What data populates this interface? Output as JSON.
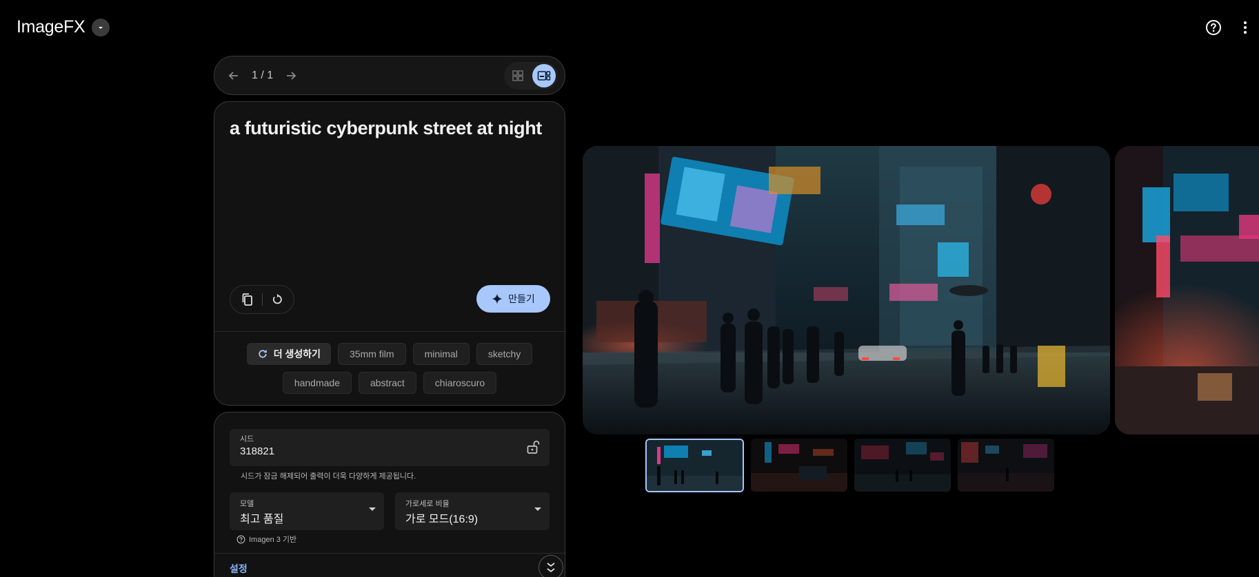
{
  "header": {
    "app_name": "ImageFX",
    "help_icon": "help-circle-icon",
    "more_icon": "more-vert-icon"
  },
  "pager": {
    "count": "1 / 1",
    "prev_icon": "arrow-left-icon",
    "next_icon": "arrow-right-icon",
    "views": [
      "grid-view-icon",
      "carousel-view-icon"
    ]
  },
  "prompt": {
    "text": "a futuristic cyberpunk street at night",
    "create_label": "만들기",
    "refresh_label": "더 생성하기",
    "chips": [
      "35mm film",
      "minimal",
      "sketchy",
      "handmade",
      "abstract",
      "chiaroscuro"
    ]
  },
  "settings": {
    "seed_label": "시드",
    "seed_value": "318821",
    "seed_hint": "시드가 잠금 해제되어 출력이 더욱 다양하게 제공됩니다.",
    "model_label": "모델",
    "model_value": "최고 품질",
    "ratio_label": "가로세로 비율",
    "ratio_value": "가로 모드(16:9)",
    "imagen_note": "Imagen 3 기반",
    "settings_label": "설정"
  },
  "colors": {
    "accent": "#a8c7fa",
    "link": "#8ab4f8",
    "background": "#000000",
    "card": "#121212"
  },
  "gallery": {
    "thumbnail_count": 4,
    "selected_index": 0
  }
}
